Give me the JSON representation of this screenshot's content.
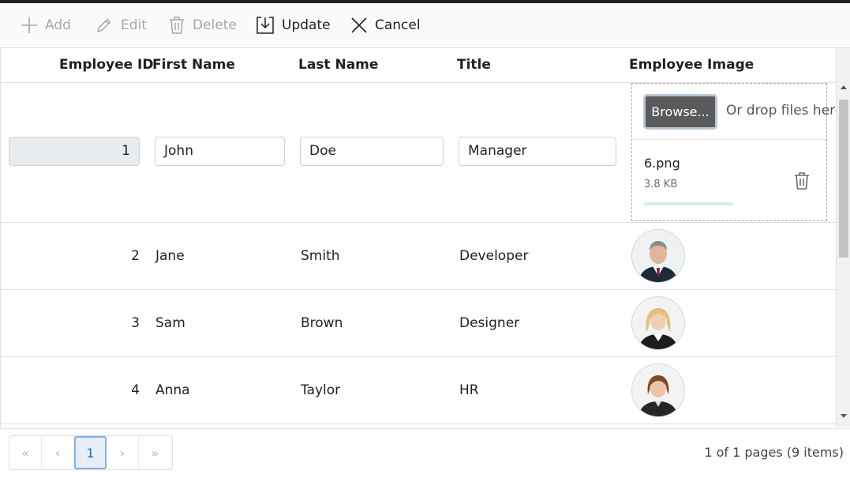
{
  "toolbar": {
    "add": "Add",
    "edit": "Edit",
    "delete": "Delete",
    "update": "Update",
    "cancel": "Cancel"
  },
  "columns": {
    "employee_id": "Employee ID",
    "first_name": "First Name",
    "last_name": "Last Name",
    "title": "Title",
    "employee_image": "Employee Image"
  },
  "edit_row": {
    "employee_id": "1",
    "first_name": "John",
    "last_name": "Doe",
    "title": "Manager",
    "uploader": {
      "browse_label": "Browse...",
      "drop_text": "Or drop files here",
      "file_name": "6.png",
      "file_size": "3.8 KB"
    }
  },
  "rows": [
    {
      "employee_id": "2",
      "first_name": "Jane",
      "last_name": "Smith",
      "title": "Developer",
      "avatar": "male-executive"
    },
    {
      "employee_id": "3",
      "first_name": "Sam",
      "last_name": "Brown",
      "title": "Designer",
      "avatar": "blonde-woman"
    },
    {
      "employee_id": "4",
      "first_name": "Anna",
      "last_name": "Taylor",
      "title": "HR",
      "avatar": "brunette-woman"
    }
  ],
  "pager": {
    "first": "«",
    "prev": "‹",
    "current_page": "1",
    "next": "›",
    "last": "»",
    "info": "1 of 1 pages (9 items)"
  },
  "colors": {
    "accent": "#1e6fb8",
    "browse_button": "#5a5a5a",
    "disabled_text": "#a6a6a6"
  }
}
